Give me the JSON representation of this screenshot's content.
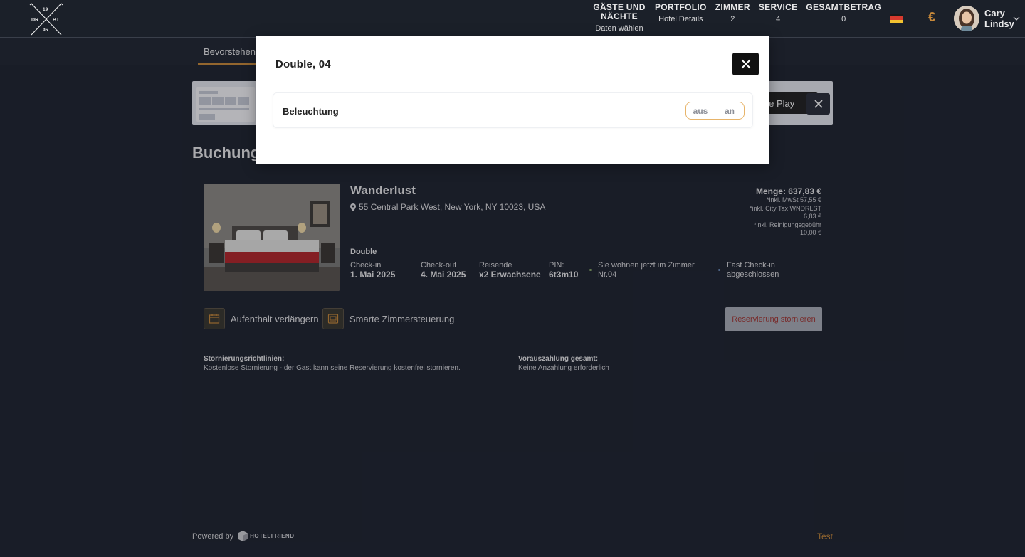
{
  "header": {
    "logo": {
      "top_left": "19",
      "top_right": "",
      "mid_left": "DR",
      "mid_right": "BT",
      "bottom_left": "95"
    },
    "nav": [
      {
        "title": "GÄSTE UND NÄCHTE",
        "value": "Daten wählen"
      },
      {
        "title": "PORTFOLIO",
        "value": "Hotel Details"
      },
      {
        "title": "ZIMMER",
        "value": "2"
      },
      {
        "title": "SERVICE",
        "value": "4"
      },
      {
        "title": "GESAMTBETRAG",
        "value": "0"
      }
    ],
    "language_icon": "german-flag-icon",
    "currency": "€",
    "user": {
      "name": "Cary Lindsy"
    }
  },
  "subnav": {
    "active_tab": "Bevorstehend"
  },
  "banner": {
    "store_label": "gle Play"
  },
  "page": {
    "title": "Buchung"
  },
  "booking": {
    "hotel_name": "Wanderlust",
    "address": "55 Central Park West, New York, NY 10023, USA",
    "price": {
      "total": "Menge: 637,83 €",
      "vat": "*inkl. MwSt  57,55 €",
      "city_tax_label": "*inkl. City Tax WNDRLST",
      "city_tax_value": "6,83 €",
      "cleaning_label": "*inkl.  Reinigungsgebühr",
      "cleaning_value": "10,00 €"
    },
    "room_type": "Double",
    "checkin_label": "Check-in",
    "checkin_value": "1. Mai 2025",
    "checkout_label": "Check-out",
    "checkout_value": "4. Mai 2025",
    "travelers_label": "Reisende",
    "travelers_value": "x2 Erwachsene",
    "pin_label": "PIN:",
    "pin_value": "6t3m10",
    "status_room_line1": "Sie wohnen jetzt im Zimmer",
    "status_room_line2": "Nr.04",
    "status_checkin_line1": "Fast Check-in",
    "status_checkin_line2": "abgeschlossen",
    "actions": {
      "extend": "Aufenthalt verlängern",
      "smart": "Smarte Zimmersteuerung",
      "cancel": "Reservierung stornieren"
    },
    "policy": {
      "cancel_title": "Stornierungsrichtlinien:",
      "cancel_text": "Kostenlose Stornierung - der Gast kann seine Reservierung kostenfrei stornieren.",
      "prepay_title": "Vorauszahlung gesamt:",
      "prepay_text": "Keine Anzahlung erforderlich"
    }
  },
  "footer": {
    "powered_by": "Powered by",
    "brand": "HOTELFRIEND",
    "link": "Test"
  },
  "modal": {
    "title": "Double, 04",
    "control_label": "Beleuchtung",
    "toggle_off": "aus",
    "toggle_on": "an"
  },
  "colors": {
    "background": "#1f2430",
    "accent": "#c8893a",
    "toggle_border": "#e7b46a",
    "cancel_text": "#a33a36"
  }
}
